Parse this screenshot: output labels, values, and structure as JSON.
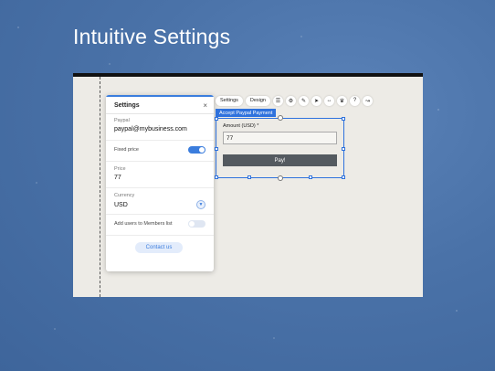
{
  "slide": {
    "title": "Intuitive Settings"
  },
  "settings_panel": {
    "title": "Settings",
    "close_glyph": "×",
    "paypal": {
      "label": "Paypal",
      "value": "paypal@mybusiness.com"
    },
    "fixed_price": {
      "label": "Fixed price",
      "enabled": true
    },
    "price": {
      "label": "Price",
      "value": "77"
    },
    "currency": {
      "label": "Currency",
      "value": "USD"
    },
    "members": {
      "label": "Add users to Members list",
      "enabled": false
    },
    "contact_button": "Contact us"
  },
  "toolbar": {
    "settings_label": "Settings",
    "design_label": "Design",
    "icons": [
      "list-check-icon",
      "gear-icon",
      "pen-icon",
      "animation-icon",
      "stretch-icon",
      "crown-icon",
      "help-icon",
      "link-icon"
    ]
  },
  "widget": {
    "tag": "Accept Paypal Payment",
    "amount_label": "Amount (USD) *",
    "amount_value": "77",
    "pay_label": "Pay!"
  },
  "colors": {
    "accent": "#3b7ddd",
    "background": "#4a72a8",
    "canvas": "#edebe6",
    "pay_button": "#545a60"
  }
}
